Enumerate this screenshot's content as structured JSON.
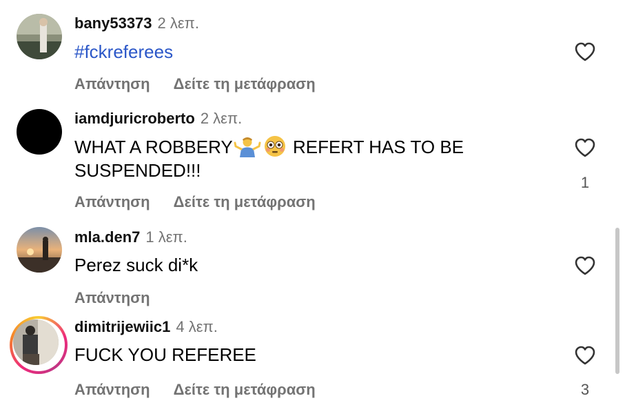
{
  "comments": [
    {
      "username": "bany53373",
      "time": "2 λεπ.",
      "text": "#fckreferees",
      "reply_label": "Απάντηση",
      "translate_label": "Δείτε τη μετάφραση",
      "avatar": "photo-avatar"
    },
    {
      "username": "iamdjuricroberto",
      "time": "2 λεπ.",
      "text_part1": "WHAT A ROBBERY",
      "text_part2": "REFERT HAS TO BE",
      "text_line2": "SUSPENDED!!!",
      "like_count": "1",
      "reply_label": "Απάντηση",
      "translate_label": "Δείτε τη μετάφραση",
      "avatar": "black-avatar"
    },
    {
      "username": "mla.den7",
      "time": "1 λεπ.",
      "text": "Perez suck di*k",
      "reply_label": "Απάντηση",
      "avatar": "sunset-avatar"
    },
    {
      "username": "dimitrijewiic1",
      "time": "4 λεπ.",
      "text": "FUCK YOU REFEREE",
      "like_count": "3",
      "reply_label": "Απάντηση",
      "translate_label": "Δείτε τη μετάφραση",
      "avatar": "story-ring-avatar"
    }
  ],
  "icons": {
    "like": "heart-outline-icon",
    "emoji1": "person-shrugging-emoji",
    "emoji2": "flushed-face-emoji"
  },
  "colors": {
    "hashtag": "#2b57c8",
    "secondary_text": "#737373",
    "story_ring_start": "#f9ce34",
    "story_ring_end": "#ee2a7b"
  }
}
